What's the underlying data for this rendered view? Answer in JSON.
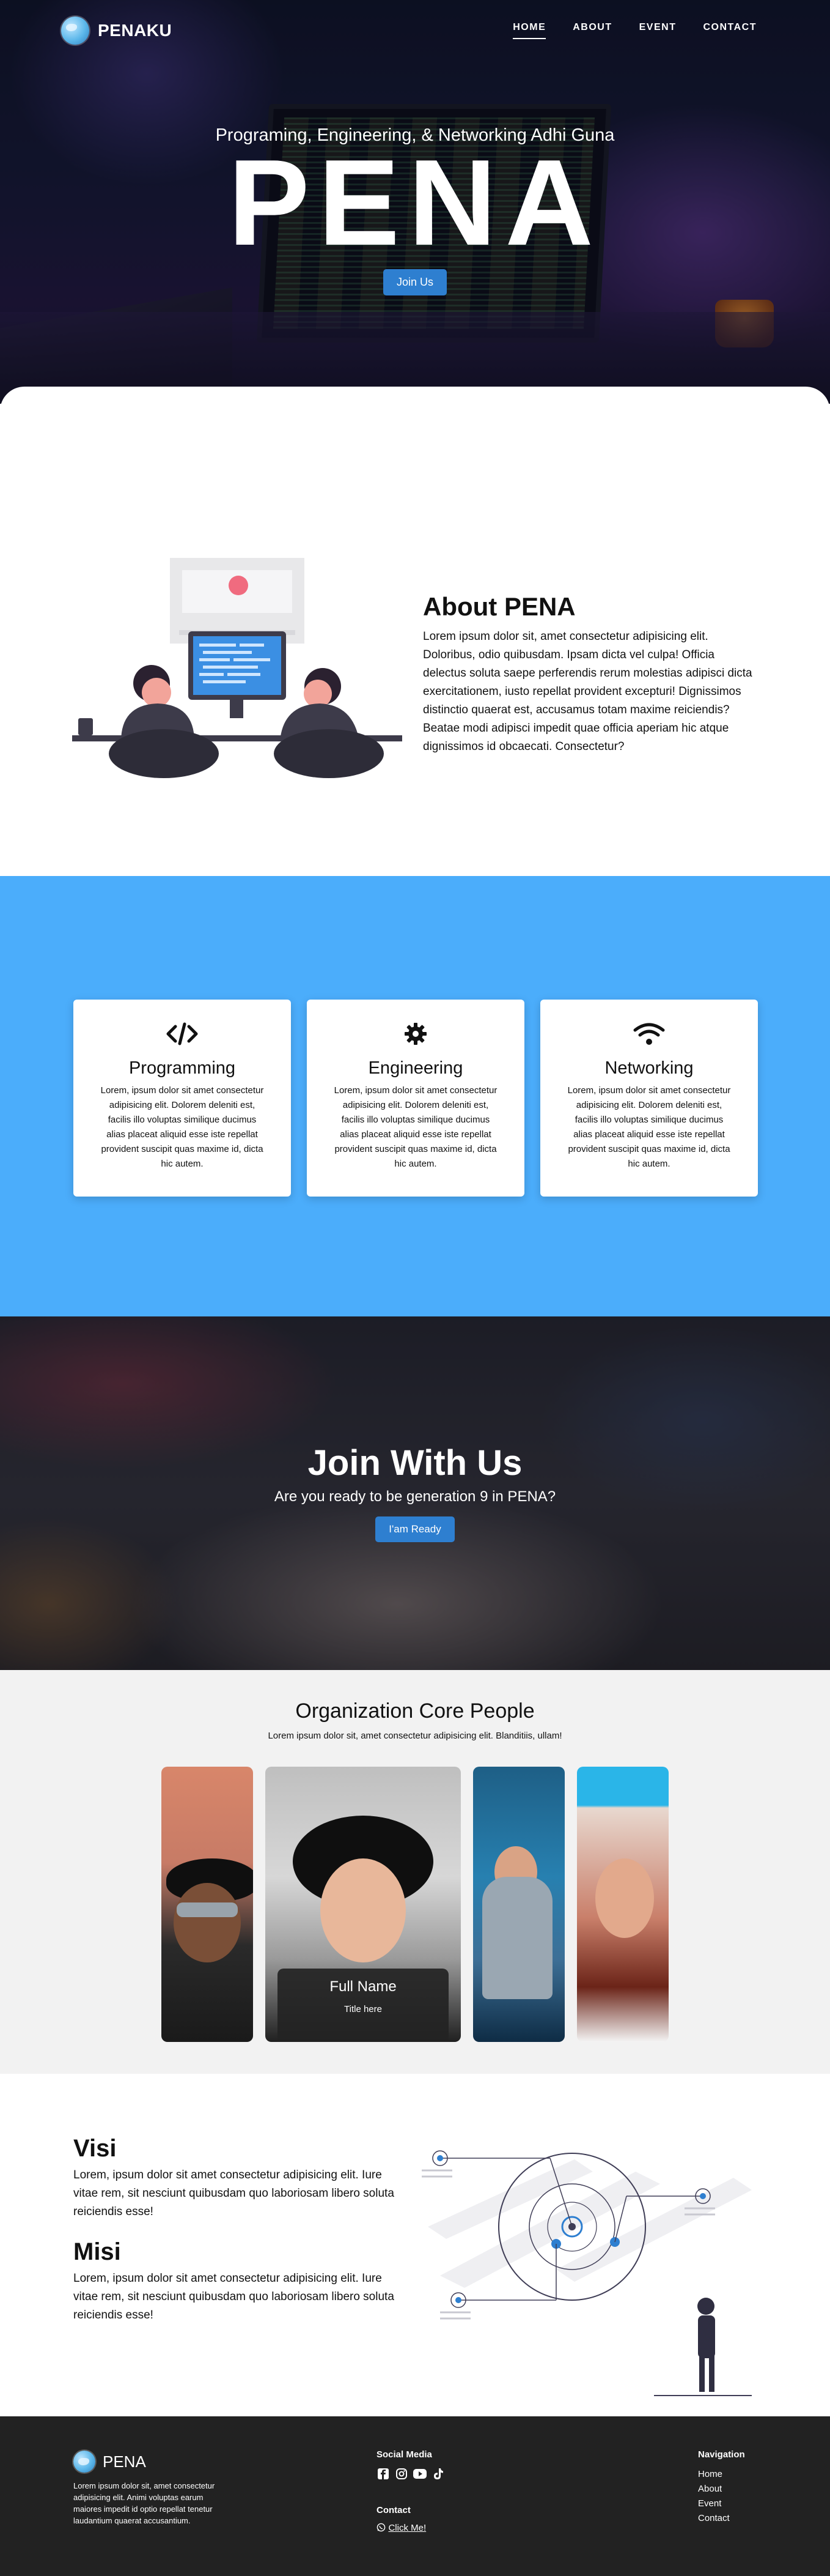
{
  "header": {
    "brand": "PENAKU",
    "nav": [
      {
        "label": "HOME"
      },
      {
        "label": "ABOUT"
      },
      {
        "label": "EVENT"
      },
      {
        "label": "CONTACT"
      }
    ]
  },
  "hero": {
    "subtitle": "Programing, Engineering, & Networking Adhi Guna",
    "title": "PENA",
    "cta": "Join Us"
  },
  "about": {
    "title": "About PENA",
    "body": "Lorem ipsum dolor sit, amet consectetur adipisicing elit. Doloribus, odio quibusdam. Ipsam dicta vel culpa! Officia delectus soluta saepe perferendis rerum molestias adipisci dicta exercitationem, iusto repellat provident excepturi! Dignissimos distinctio quaerat est, accusamus totam maxime reiciendis? Beatae modi adipisci impedit quae officia aperiam hic atque dignissimos id obcaecati. Consectetur?"
  },
  "services": [
    {
      "icon": "code-icon",
      "title": "Programming",
      "body": "Lorem, ipsum dolor sit amet consectetur adipisicing elit. Dolorem deleniti est, facilis illo voluptas similique ducimus alias placeat aliquid esse iste repellat provident suscipit quas maxime id, dicta hic autem."
    },
    {
      "icon": "gear-icon",
      "title": "Engineering",
      "body": "Lorem, ipsum dolor sit amet consectetur adipisicing elit. Dolorem deleniti est, facilis illo voluptas similique ducimus alias placeat aliquid esse iste repellat provident suscipit quas maxime id, dicta hic autem."
    },
    {
      "icon": "wifi-icon",
      "title": "Networking",
      "body": "Lorem, ipsum dolor sit amet consectetur adipisicing elit. Dolorem deleniti est, facilis illo voluptas similique ducimus alias placeat aliquid esse iste repellat provident suscipit quas maxime id, dicta hic autem."
    }
  ],
  "join": {
    "title": "Join With Us",
    "subtitle": "Are you ready to be generation 9 in PENA?",
    "cta": "I'am Ready"
  },
  "team": {
    "title": "Organization Core People",
    "lead": "Lorem ipsum dolor sit, amet consectetur adipisicing elit. Blanditiis, ullam!",
    "active_name": "Full Name",
    "active_title": "Title here"
  },
  "visi": {
    "title": "Visi",
    "body": "Lorem, ipsum dolor sit amet consectetur adipisicing elit. Iure vitae rem, sit nesciunt quibusdam quo laboriosam libero soluta reiciendis esse!"
  },
  "misi": {
    "title": "Misi",
    "body": "Lorem, ipsum dolor sit amet consectetur adipisicing elit. Iure vitae rem, sit nesciunt quibusdam quo laboriosam libero soluta reiciendis esse!"
  },
  "footer": {
    "brand": "PENA",
    "about": "Lorem ipsum dolor sit, amet consectetur adipisicing elit. Animi voluptas earum maiores impedit id optio repellat tenetur laudantium quaerat accusantium.",
    "social_heading": "Social Media",
    "contact_heading": "Contact",
    "contact_link": "Click Me!",
    "nav_heading": "Navigation",
    "nav": [
      "Home",
      "About",
      "Event",
      "Contact"
    ]
  },
  "colors": {
    "accent": "#4badfb",
    "button": "#2e7fd0",
    "footer_bg": "#222222"
  }
}
